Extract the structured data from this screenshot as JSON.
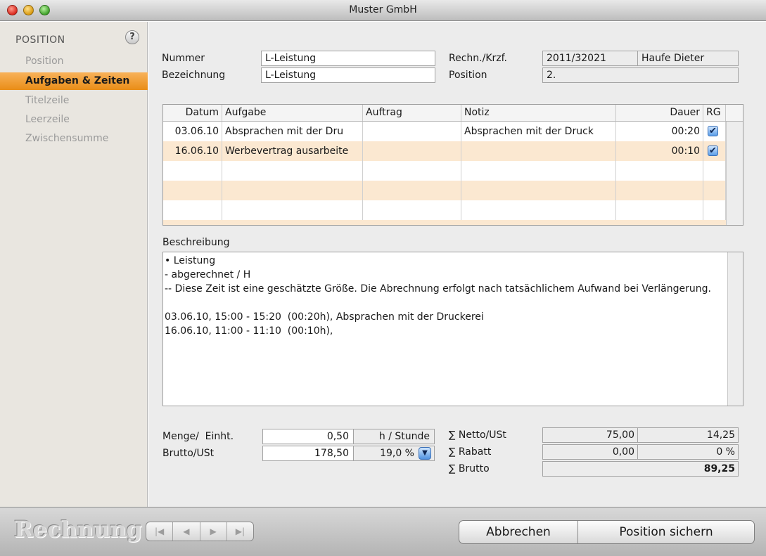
{
  "window": {
    "title": "Muster GmbH"
  },
  "sidebar": {
    "heading": "POSITION",
    "items": [
      {
        "label": "Position"
      },
      {
        "label": "Aufgaben & Zeiten"
      },
      {
        "label": "Titelzeile"
      },
      {
        "label": "Leerzeile"
      },
      {
        "label": "Zwischensumme"
      }
    ]
  },
  "header": {
    "nummer_label": "Nummer",
    "nummer_value": "L-Leistung",
    "bezeichnung_label": "Bezeichnung",
    "bezeichnung_value": "L-Leistung",
    "rechn_label": "Rechn./Krzf.",
    "rechn_value": "2011/32021",
    "kunde_value": "Haufe Dieter",
    "position_label": "Position",
    "position_value": "2."
  },
  "table": {
    "columns": [
      "Datum",
      "Aufgabe",
      "Auftrag",
      "Notiz",
      "Dauer",
      "RG"
    ],
    "rows": [
      {
        "datum": "03.06.10",
        "aufgabe": "Absprachen mit der Dru",
        "auftrag": "",
        "notiz": "Absprachen mit der Druck",
        "dauer": "00:20",
        "rg": "✔"
      },
      {
        "datum": "16.06.10",
        "aufgabe": "Werbevertrag ausarbeite",
        "auftrag": "",
        "notiz": "",
        "dauer": "00:10",
        "rg": "✔"
      }
    ]
  },
  "beschreibung": {
    "label": "Beschreibung",
    "text": "• Leistung\n- abgerechnet / H\n-- Diese Zeit ist eine geschätzte Größe. Die Abrechnung erfolgt nach tatsächlichem Aufwand bei Verlängerung.\n\n03.06.10, 15:00 - 15:20  (00:20h), Absprachen mit der Druckerei\n16.06.10, 11:00 - 11:10  (00:10h),"
  },
  "menge": {
    "label": "Menge/  Einht.",
    "value": "0,50",
    "unit": "h / Stunde",
    "brutto_label": "Brutto/USt",
    "brutto_value": "178,50",
    "ust_value": "19,0 %"
  },
  "totals": {
    "netto_label": "∑ Netto/USt",
    "netto_value": "75,00",
    "ust_value": "14,25",
    "rabatt_label": "∑ Rabatt",
    "rabatt_value": "0,00",
    "rabatt_pct": "0 %",
    "brutto_label": "∑ Brutto",
    "brutto_value": "89,25"
  },
  "bottombar": {
    "app_name": "Rechnung",
    "nav": [
      "|◀",
      "◀",
      "▶",
      "▶|"
    ],
    "cancel_label": "Abbrechen",
    "save_label": "Position sichern"
  },
  "colors": {
    "accent": "#e98d17",
    "row_alt": "#fbe8d1"
  }
}
